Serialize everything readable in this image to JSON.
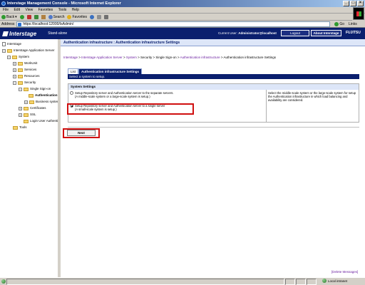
{
  "window": {
    "title": "Interstage Management Console - Microsoft Internet Explorer",
    "buttons": [
      "_",
      "□",
      "×"
    ]
  },
  "menu": [
    "File",
    "Edit",
    "View",
    "Favorites",
    "Tools",
    "Help"
  ],
  "toolbar": {
    "back": "Back",
    "search": "Search",
    "favorites": "Favorites"
  },
  "address": {
    "label": "Address",
    "url": "https://localhost:12000/IsAdmin/",
    "go": "Go",
    "links": "Links"
  },
  "header": {
    "logo": "Interstage",
    "mode": "Stand-alone",
    "current_user_label": "Current User:",
    "current_user": "Administrator@localhost",
    "logout": "Logout",
    "about": "About Interstage",
    "brand": "FUJITSU"
  },
  "tree": {
    "items": [
      {
        "label": "Interstage"
      },
      {
        "label": "Interstage Application Server"
      },
      {
        "label": "System"
      },
      {
        "label": "WorkUnit"
      },
      {
        "label": "Services"
      },
      {
        "label": "Resources"
      },
      {
        "label": "Security"
      },
      {
        "label": "Single Sign-on"
      },
      {
        "label": "Authentication"
      },
      {
        "label": "Business system"
      },
      {
        "label": "Certificates"
      },
      {
        "label": "SSL"
      },
      {
        "label": "Login User Authentic"
      },
      {
        "label": "Tools"
      }
    ]
  },
  "page": {
    "title": "Authentication infrastructure : Authentication infrastructure Settings",
    "breadcrumb": {
      "crumbs": [
        "Interstage",
        "Interstage Application Server",
        "System",
        "Security",
        "Single Sign-on",
        "Authentication infrastructure"
      ],
      "separator": " > ",
      "current": "Authentication infrastructure Settings"
    },
    "tabs": {
      "list": "List",
      "active": "Authentication infrastructure Settings"
    },
    "instruction": "Select a system to setup.",
    "section_title": "System Settings",
    "options": [
      {
        "line1": "Setup Repository server and Authentication server to the separate servers.",
        "line2": "(A middle-scale system or a large-scale system is setup.)",
        "selected": false
      },
      {
        "line1": "Setup Repository server and Authentication server to a single server",
        "line2": "(A small-scale system is setup.)",
        "selected": true
      }
    ],
    "description": "Select the middle-scale system or the large-scale system for setup the Authentication infrastructure in which load balancing and availability are considered.",
    "next_button": "Next",
    "delete_messages": "[Delete Messages]"
  },
  "status": {
    "zone": "Local intranet"
  }
}
